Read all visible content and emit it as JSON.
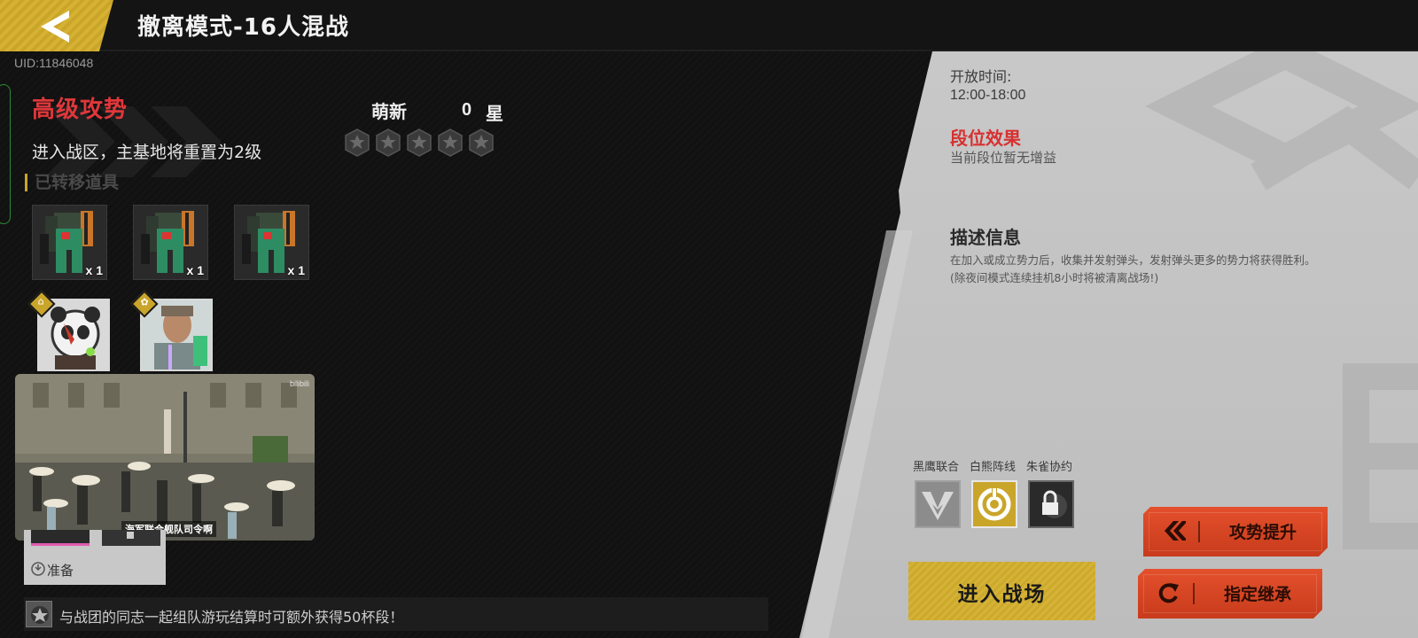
{
  "header": {
    "title": "撤离模式-16人混战",
    "uid": "UID:11846048"
  },
  "left": {
    "attack_title": "高级攻势",
    "attack_desc": "进入战区，主基地将重置为2级",
    "transferred_label": "已转移道具",
    "items": [
      {
        "name": "mech-unit",
        "qty": "x 1"
      },
      {
        "name": "mech-unit",
        "qty": "x 1"
      },
      {
        "name": "mech-unit",
        "qty": "x 1"
      }
    ],
    "ready_text": "准备"
  },
  "rank": {
    "name": "萌新",
    "stars_count": "0",
    "stars_label": "星",
    "stars_filled": 0,
    "stars_total": 5
  },
  "video": {
    "caption": "海军联合舰队司令啊",
    "watermark": "bilibili"
  },
  "tip": {
    "text": "与战团的同志一起组队游玩结算时可额外获得50杯段！"
  },
  "right": {
    "open_time_label": "开放时间:",
    "open_time_value": "12:00-18:00",
    "rank_effect_title": "段位效果",
    "rank_effect_desc": "当前段位暂无增益",
    "desc_title": "描述信息",
    "desc_line1": "在加入或成立势力后，收集并发射弹头，发射弹头更多的势力将获得胜利。",
    "desc_line2": "(除夜间模式连续挂机8小时将被清离战场!)"
  },
  "factions": [
    {
      "label": "黑鹰联合",
      "icon": "black-eagle-icon",
      "state": "available"
    },
    {
      "label": "白熊阵线",
      "icon": "white-bear-icon",
      "state": "selected"
    },
    {
      "label": "朱雀协约",
      "icon": "vermilion-bird-icon",
      "state": "locked"
    }
  ],
  "buttons": {
    "enter": "进入战场",
    "offense_up": "攻势提升",
    "inherit": "指定继承"
  },
  "colors": {
    "accent_gold": "#c9a52a",
    "accent_red": "#e0373a",
    "button_orange": "#d8452a"
  }
}
